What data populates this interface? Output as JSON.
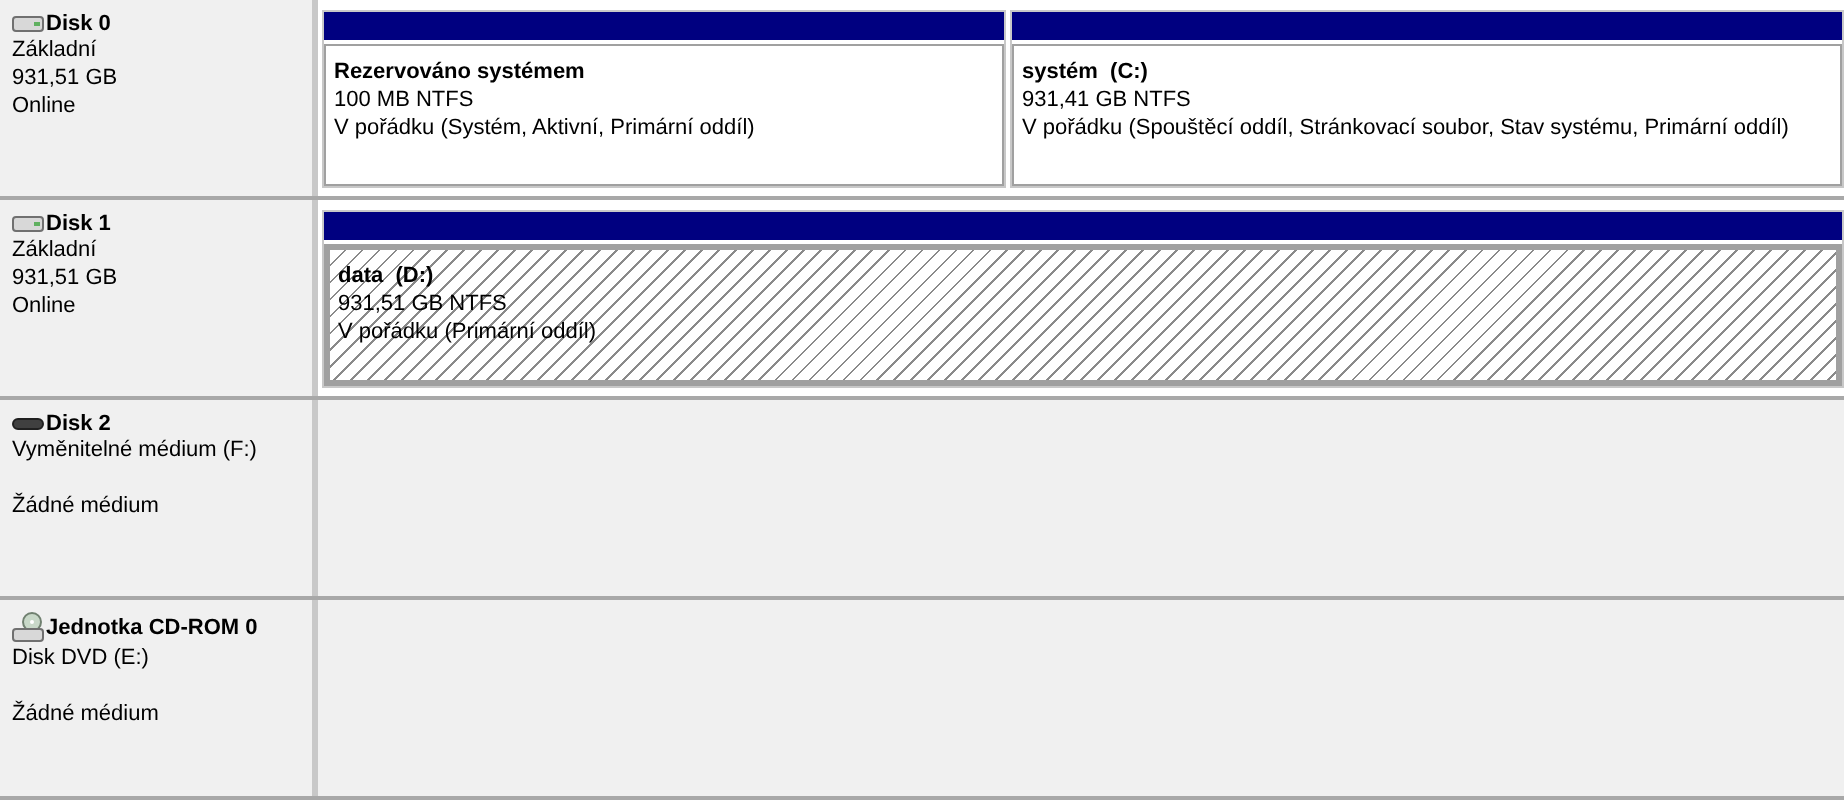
{
  "disks": [
    {
      "name": "Disk 0",
      "kind": "hdd",
      "type": "Základní",
      "capacity": "931,51 GB",
      "status": "Online",
      "partitions": [
        {
          "title": "Rezervováno systémem",
          "size": "100 MB NTFS",
          "state": "V pořádku (Systém, Aktivní, Primární oddíl)",
          "selected": false
        },
        {
          "title": "systém  (C:)",
          "size": "931,41 GB NTFS",
          "state": "V pořádku (Spouštěcí oddíl, Stránkovací soubor, Stav systému, Primární oddíl)",
          "selected": false
        }
      ]
    },
    {
      "name": "Disk 1",
      "kind": "hdd",
      "type": "Základní",
      "capacity": "931,51 GB",
      "status": "Online",
      "partitions": [
        {
          "title": "data  (D:)",
          "size": "931,51 GB NTFS",
          "state": "V pořádku (Primární oddíl)",
          "selected": true
        }
      ]
    },
    {
      "name": "Disk 2",
      "kind": "removable",
      "type": "Vyměnitelné médium (F:)",
      "status": "Žádné médium"
    },
    {
      "name": "Jednotka CD-ROM 0",
      "kind": "cdrom",
      "type": "Disk DVD (E:)",
      "status": "Žádné médium"
    }
  ]
}
